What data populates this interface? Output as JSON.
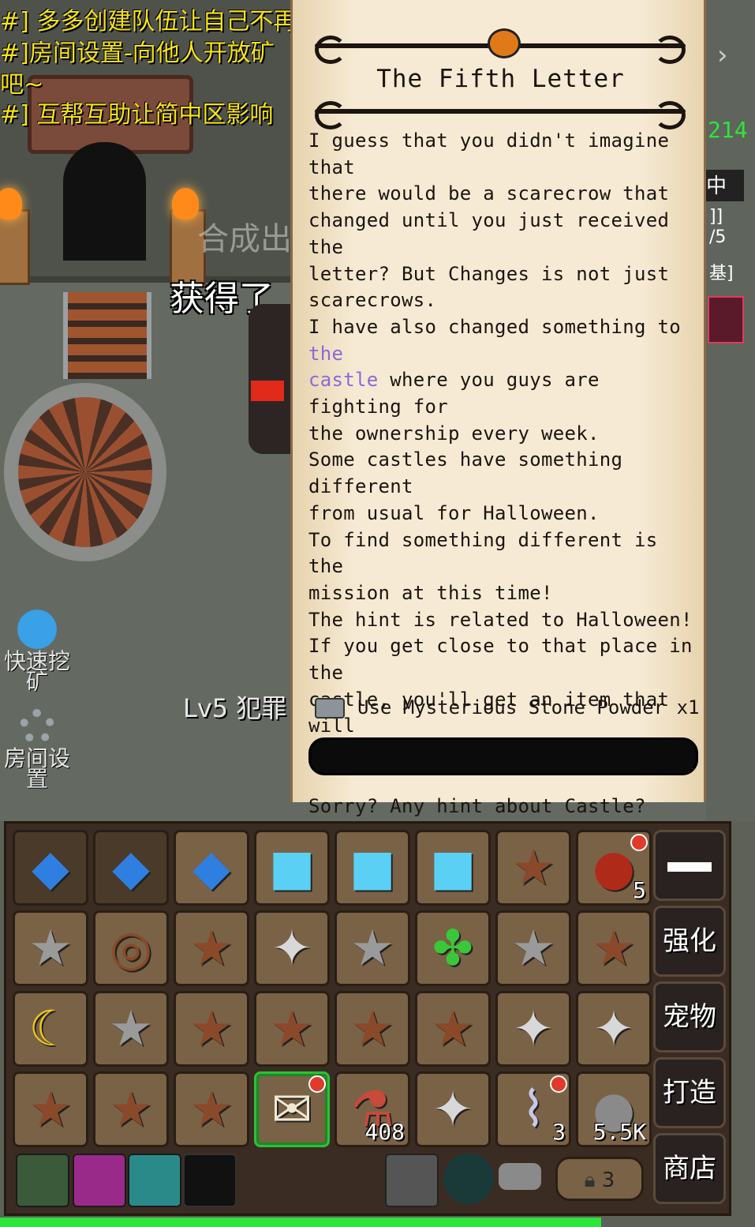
{
  "background": {
    "chat_lines": [
      "#] 多多创建队伍让自己不再",
      "#]房间设置-向他人开放矿",
      "吧~",
      "#] 互帮互助让简中区影响"
    ],
    "floating_text_1": "合成出",
    "floating_text_2": "获得了",
    "side_buttons": {
      "quick_mine": "快速挖矿",
      "room_settings": "房间设置"
    },
    "player_label": "Lv5 犯罪",
    "right_partial": [
      "214",
      "中",
      "]]",
      "/5",
      "基]"
    ]
  },
  "letter": {
    "title": "The Fifth Letter",
    "body_parts": [
      {
        "text": "I guess that you didn't imagine that\nthere would be a scarecrow that\nchanged until you just received the\nletter? But Changes is not just\nscarecrows.\nI have also changed something to ",
        "highlight": false
      },
      {
        "text": "the\ncastle",
        "highlight": true
      },
      {
        "text": " where you guys are fighting for\nthe ownership every week.\nSome castles have something different\nfrom usual for Halloween.\nTo find something different is the\nmission at this time!\nThe hint is related to Halloween!\nIf you get close to that place in the\ncastle, you'll get an item that will\nshow you the next letter!\n\nSorry? Any hint about Castle? haha\nsee this letter again! The hint is\nalready in the letter!\"",
        "highlight": false
      }
    ],
    "use_action": "Use Mysterious Stone Powder x1",
    "input_value": ""
  },
  "inventory": {
    "rows": [
      [
        {
          "icon": "blue-crystal-shard-icon",
          "glyph": "◆",
          "color": "#2f7fe0",
          "dark": true
        },
        {
          "icon": "blue-crystal-shard-icon",
          "glyph": "◆",
          "color": "#2f7fe0",
          "dark": true
        },
        {
          "icon": "blue-crystal-shard-icon",
          "glyph": "◆",
          "color": "#2f7fe0"
        },
        {
          "icon": "ice-cube-icon",
          "glyph": "■",
          "color": "#5ad0f5"
        },
        {
          "icon": "ice-cube-icon",
          "glyph": "■",
          "color": "#5ad0f5"
        },
        {
          "icon": "ice-cube-icon",
          "glyph": "■",
          "color": "#5ad0f5"
        },
        {
          "icon": "brown-star-icon",
          "glyph": "★",
          "color": "#8a4a2a"
        },
        {
          "icon": "red-potion-bag-icon",
          "glyph": "●",
          "color": "#b02a1a",
          "count": "5",
          "no": true
        }
      ],
      [
        {
          "icon": "silver-star-icon",
          "glyph": "★",
          "color": "#9a9a9a"
        },
        {
          "icon": "donut-icon",
          "glyph": "◎",
          "color": "#8a4a28"
        },
        {
          "icon": "brown-star-icon",
          "glyph": "★",
          "color": "#8a4a2a"
        },
        {
          "icon": "shuriken-icon",
          "glyph": "✦",
          "color": "#d8d8d8"
        },
        {
          "icon": "silver-star-icon",
          "glyph": "★",
          "color": "#9a9a9a"
        },
        {
          "icon": "four-leaf-clover-icon",
          "glyph": "✤",
          "color": "#3ac83a"
        },
        {
          "icon": "silver-star-icon",
          "glyph": "★",
          "color": "#9a9a9a"
        },
        {
          "icon": "brown-star-icon",
          "glyph": "★",
          "color": "#8a4a2a"
        }
      ],
      [
        {
          "icon": "crescent-moon-icon",
          "glyph": "☾",
          "color": "#f0c81a"
        },
        {
          "icon": "silver-star-icon",
          "glyph": "★",
          "color": "#9a9a9a"
        },
        {
          "icon": "brown-star-icon",
          "glyph": "★",
          "color": "#8a4a2a"
        },
        {
          "icon": "brown-star-icon",
          "glyph": "★",
          "color": "#8a4a2a"
        },
        {
          "icon": "brown-star-icon",
          "glyph": "★",
          "color": "#8a4a2a"
        },
        {
          "icon": "brown-star-icon",
          "glyph": "★",
          "color": "#8a4a2a"
        },
        {
          "icon": "shuriken-icon",
          "glyph": "✦",
          "color": "#d8d8d8"
        },
        {
          "icon": "shuriken-icon",
          "glyph": "✦",
          "color": "#d8d8d8"
        }
      ],
      [
        {
          "icon": "brown-star-icon",
          "glyph": "★",
          "color": "#8a4a2a"
        },
        {
          "icon": "brown-star-icon",
          "glyph": "★",
          "color": "#8a4a2a"
        },
        {
          "icon": "brown-star-icon",
          "glyph": "★",
          "color": "#8a4a2a"
        },
        {
          "icon": "halloween-letter-icon",
          "glyph": "✉",
          "color": "#f0e8d0",
          "selected": true,
          "no": true
        },
        {
          "icon": "bottle-icon",
          "glyph": "⚗",
          "color": "#c84a3a",
          "count": "408"
        },
        {
          "icon": "shuriken-icon",
          "glyph": "✦",
          "color": "#d8d8d8"
        },
        {
          "icon": "wire-tool-icon",
          "glyph": "⌇",
          "color": "#c8c8e8",
          "count": "3",
          "no": true
        },
        {
          "icon": "stone-powder-icon",
          "glyph": "●",
          "color": "#8a8a8a",
          "count": "5.5K"
        }
      ]
    ],
    "side_buttons": [
      "",
      "强化",
      "宠物",
      "打造",
      "商店"
    ],
    "lock_count": "3"
  },
  "colors": {
    "parchment": "#f6ead4",
    "ink": "#1b1410",
    "highlight": "#8a6ad8",
    "select_green": "#2ee53a"
  }
}
